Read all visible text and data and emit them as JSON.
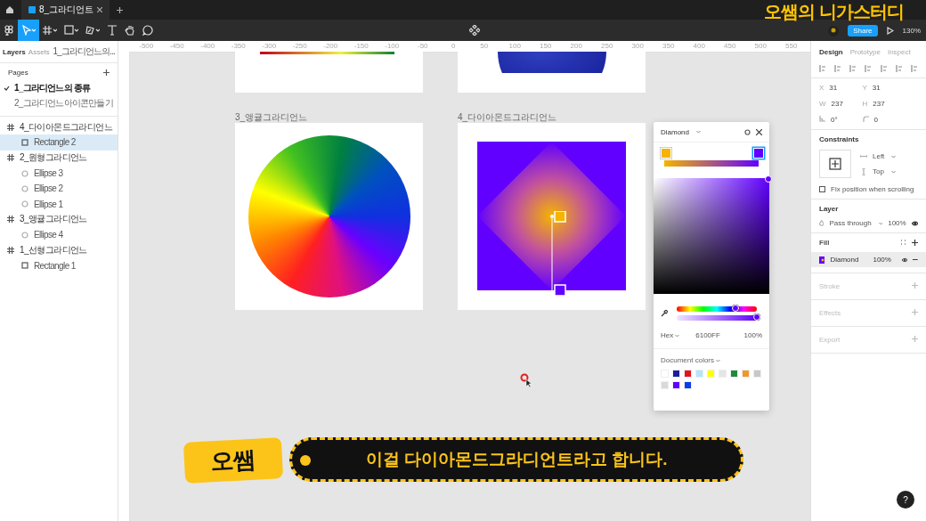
{
  "tabs": [
    {
      "label": "8_그라디언트",
      "selected": true
    }
  ],
  "toolbar": {
    "share": "Share",
    "zoom": "130%"
  },
  "left_panel": {
    "tabs": [
      {
        "label": "Layers",
        "selected": true
      },
      {
        "label": "Assets",
        "selected": false
      }
    ],
    "page_select": "1_그라디언느의...",
    "pages_title": "Pages",
    "pages": [
      {
        "label": "1_그라디언느의 종류",
        "selected": true
      },
      {
        "label": "2_그라디언느아이콘만들기",
        "selected": false
      }
    ],
    "layers": [
      {
        "name": "4_다이아몬드그라디언느",
        "kind": "frame",
        "selected": false,
        "children": [
          {
            "name": "Rectangle 2",
            "kind": "rect",
            "selected": true
          }
        ]
      },
      {
        "name": "2_원형그라디언느",
        "kind": "frame",
        "selected": false,
        "children": [
          {
            "name": "Ellipse 3",
            "kind": "ellipse",
            "selected": false
          },
          {
            "name": "Ellipse 2",
            "kind": "ellipse",
            "selected": false
          },
          {
            "name": "Ellipse 1",
            "kind": "ellipse",
            "selected": false
          }
        ]
      },
      {
        "name": "3_앵귤그라디언느",
        "kind": "frame",
        "selected": false,
        "children": [
          {
            "name": "Ellipse 4",
            "kind": "ellipse",
            "selected": false
          }
        ]
      },
      {
        "name": "1_선형그라디언느",
        "kind": "frame",
        "selected": false,
        "children": [
          {
            "name": "Rectangle 1",
            "kind": "rect",
            "selected": false
          }
        ]
      }
    ]
  },
  "canvas": {
    "ruler": [
      "-500",
      "-450",
      "-400",
      "-350",
      "-300",
      "-250",
      "-200",
      "-150",
      "-100",
      "-50",
      "0",
      "50",
      "100",
      "150",
      "200",
      "250",
      "300",
      "350",
      "400",
      "450",
      "500",
      "550"
    ],
    "frames": [
      {
        "kind": "linear"
      },
      {
        "kind": "radial"
      },
      {
        "kind": "angular",
        "label": "3_앵귤그라디언느"
      },
      {
        "kind": "diamond",
        "label": "4_다이아몬드그라디언느"
      }
    ]
  },
  "color_picker": {
    "type": "Diamond",
    "stops": [
      {
        "color": "#f5b400",
        "selected": false
      },
      {
        "color": "#6100ff",
        "selected": true
      }
    ],
    "hue": {
      "level": 0.73
    },
    "opacity": {
      "level": 1
    },
    "format": "Hex",
    "hex": "6100FF",
    "alpha": "100%",
    "swatches_title": "Document colors",
    "swatches": [
      {
        "color": "#ffffff"
      },
      {
        "color": "#1a1f9c"
      },
      {
        "color": "#e0161b"
      },
      {
        "color": "#b3e5fc"
      },
      {
        "color": "#ffff00"
      },
      {
        "color": "#e5e5e5"
      },
      {
        "color": "#1e8a3c"
      },
      {
        "color": "#f0962e"
      },
      {
        "color": "#c8c8c8"
      },
      {
        "color": "#d9d9d9"
      },
      {
        "color": "#6100ff"
      },
      {
        "color": "#0a3ee8"
      }
    ]
  },
  "design_panel": {
    "tabs": [
      {
        "label": "Design",
        "selected": true
      },
      {
        "label": "Prototype",
        "selected": false
      },
      {
        "label": "Inspect",
        "selected": false
      }
    ],
    "fields": [
      {
        "label": "X",
        "value": "31"
      },
      {
        "label": "Y",
        "value": "31"
      },
      {
        "label": "W",
        "value": "237"
      },
      {
        "label": "H",
        "value": "237"
      }
    ],
    "rotation": "0°",
    "radius": "0",
    "constraints_title": "Constraints",
    "horizontal": "Left",
    "vertical": "Top",
    "fix_position": {
      "label": "Fix position when scrolling",
      "checked": false
    },
    "layer_title": "Layer",
    "blend": "Pass through",
    "layer_opacity": "100%",
    "fill_title": "Fill",
    "fill": {
      "name": "Diamond",
      "opacity": "100%"
    },
    "sections": [
      "Stroke",
      "Effects",
      "Export"
    ]
  },
  "overlay": {
    "channel_title": "오쌤의 니가스터디",
    "speaker": "오쌤",
    "subtitle": "이걸 다이아몬드그라디언트라고 합니다."
  },
  "help": "?"
}
